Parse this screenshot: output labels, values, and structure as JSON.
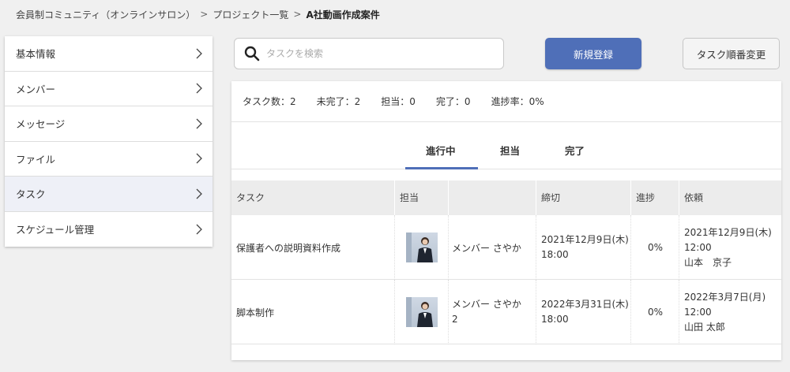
{
  "breadcrumb": {
    "level1": "会員制コミュニティ（オンラインサロン）",
    "sep1": ">",
    "level2": "プロジェクト一覧",
    "sep2": ">",
    "current": "A社動画作成案件"
  },
  "sidebar": {
    "items": [
      {
        "label": "基本情報"
      },
      {
        "label": "メンバー"
      },
      {
        "label": "メッセージ"
      },
      {
        "label": "ファイル"
      },
      {
        "label": "タスク"
      },
      {
        "label": "スケジュール管理"
      }
    ]
  },
  "search": {
    "placeholder": "タスクを検索",
    "value": ""
  },
  "toolbar": {
    "new_label": "新規登録",
    "reorder_label": "タスク順番変更",
    "accent_color": "#4f6fb8"
  },
  "stats": {
    "total": "タスク数：2",
    "incomplete": "未完了：2",
    "assigned": "担当：0",
    "done": "完了：0",
    "progress": "進捗率：0%"
  },
  "tabs": [
    {
      "label": "進行中"
    },
    {
      "label": "担当"
    },
    {
      "label": "完了"
    }
  ],
  "table": {
    "headers": [
      "タスク",
      "担当",
      "",
      "締切",
      "進捗",
      "依頼"
    ],
    "rows": [
      {
        "task": "保護者への説明資料作成",
        "assignee": "メンバー さやか",
        "deadline_date": "2021年12月9日(木)",
        "deadline_time": "18:00",
        "progress": "0%",
        "request_date": "2021年12月9日(木)",
        "request_time": "12:00",
        "requester": "山本　京子"
      },
      {
        "task": "脚本制作",
        "assignee_line1": "メンバー さやか",
        "assignee_line2": "2",
        "deadline_date": "2022年3月31日(木)",
        "deadline_time": "18:00",
        "progress": "0%",
        "request_date": "2022年3月7日(月)",
        "request_time": "12:00",
        "requester": "山田 太郎"
      }
    ]
  }
}
